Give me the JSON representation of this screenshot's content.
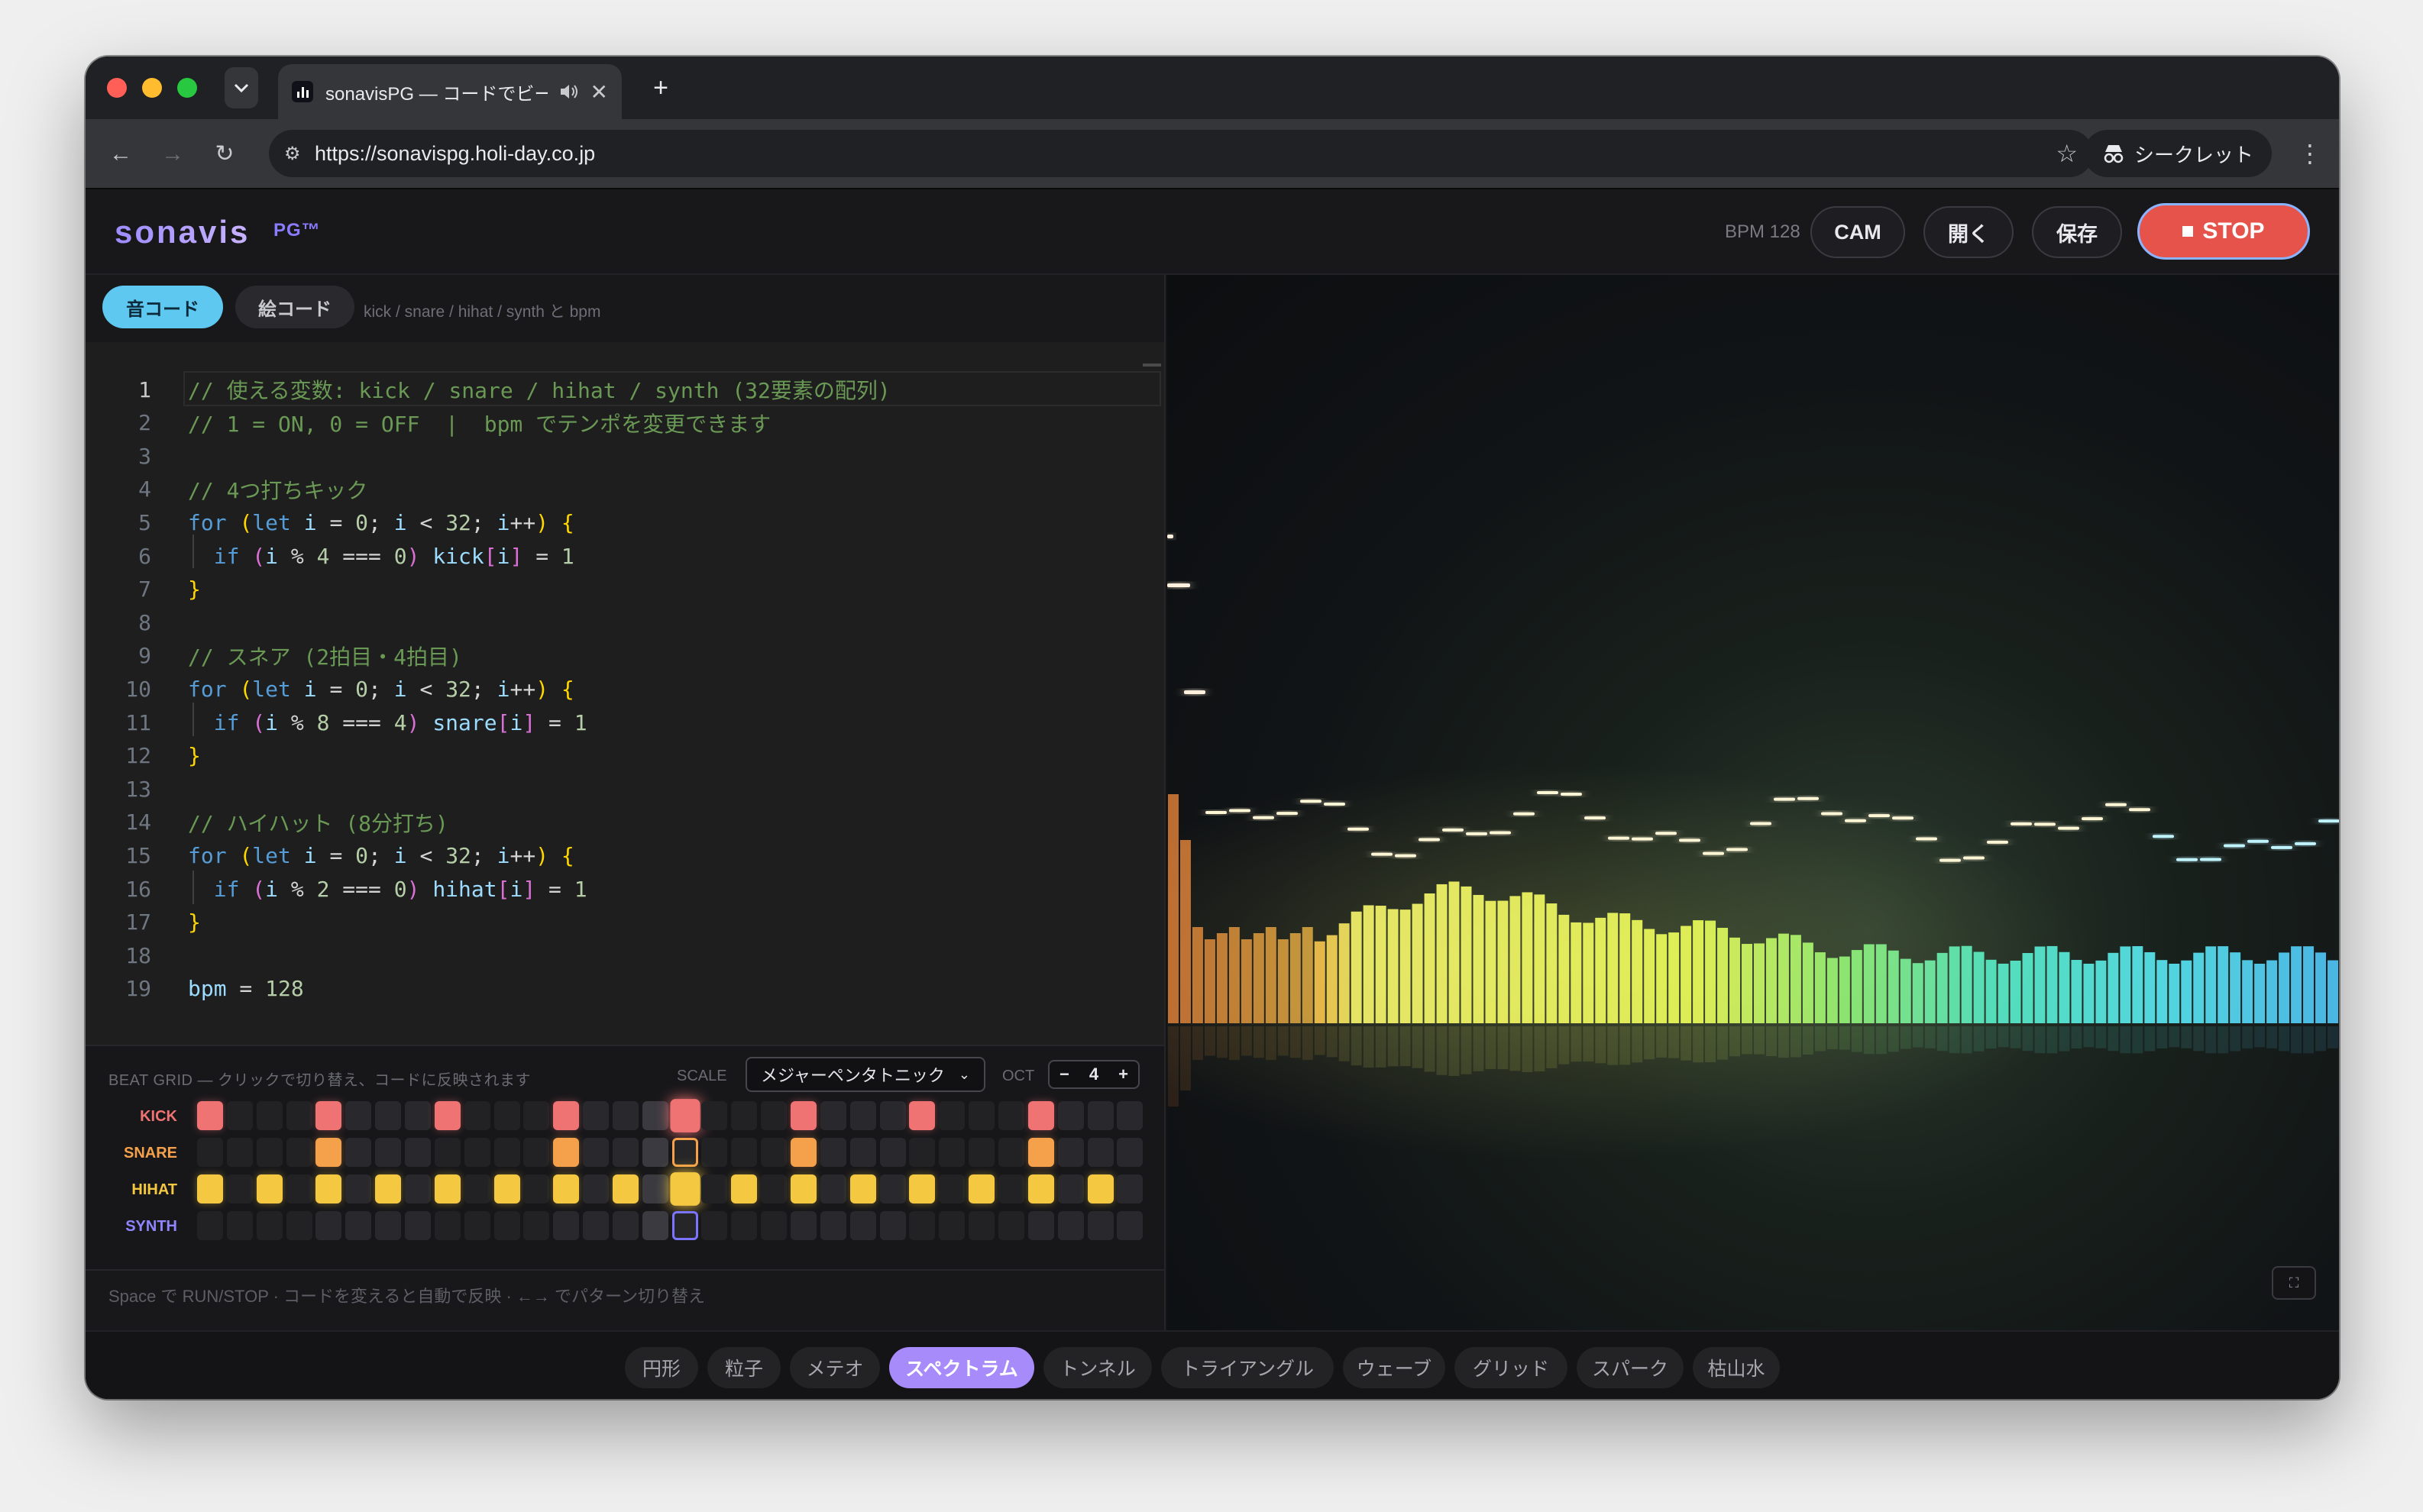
{
  "browser": {
    "tab_title": "sonavisPG — コードでビー",
    "tab_audio_icon": "speaker-icon",
    "url": "https://sonavispg.holi-day.co.jp",
    "incognito_label": "シークレット"
  },
  "app": {
    "logo": "sonavis",
    "logo_sub": "PG™",
    "bpm_label": "BPM 128",
    "buttons": {
      "cam": "CAM",
      "open": "開く",
      "save": "保存",
      "stop": "STOP"
    }
  },
  "modebar": {
    "sound_code": "音コード",
    "picture_code": "絵コード",
    "hint": "kick / snare / hihat / synth と bpm"
  },
  "editor": {
    "current_line": 1,
    "lines": [
      "// 使える変数: kick / snare / hihat / synth (32要素の配列)",
      "// 1 = ON, 0 = OFF  |  bpm でテンポを変更できます",
      "",
      "// 4つ打ちキック",
      "for (let i = 0; i < 32; i++) {",
      "  if (i % 4 === 0) kick[i] = 1",
      "}",
      "",
      "// スネア (2拍目・4拍目)",
      "for (let i = 0; i < 32; i++) {",
      "  if (i % 8 === 4) snare[i] = 1",
      "}",
      "",
      "// ハイハット (8分打ち)",
      "for (let i = 0; i < 32; i++) {",
      "  if (i % 2 === 0) hihat[i] = 1",
      "}",
      "",
      "bpm = 128"
    ]
  },
  "beat_grid": {
    "title": "BEAT GRID — クリックで切り替え、コードに反映されます",
    "scale_label": "SCALE",
    "scale_value": "メジャーペンタトニック",
    "oct_label": "OCT",
    "oct_value": "4",
    "playhead_step": 16,
    "tracks": [
      {
        "name": "KICK",
        "color": "#f07373",
        "steps": [
          0,
          4,
          8,
          12,
          16,
          20,
          24,
          28
        ]
      },
      {
        "name": "SNARE",
        "color": "#f5a04a",
        "steps": [
          4,
          12,
          20,
          28
        ]
      },
      {
        "name": "HIHAT",
        "color": "#f5c842",
        "steps": [
          0,
          2,
          4,
          6,
          8,
          10,
          12,
          14,
          16,
          18,
          20,
          22,
          24,
          26,
          28,
          30
        ]
      },
      {
        "name": "SYNTH",
        "color": "#8f86ff",
        "steps": []
      }
    ],
    "footnote": "Space で RUN/STOP · コードを変えると自動で反映 · ←→ でパターン切り替え"
  },
  "visual_modes": {
    "active": "スペクトラム",
    "items": [
      "円形",
      "粒子",
      "メテオ",
      "スペクトラム",
      "トンネル",
      "トライアングル",
      "ウェーブ",
      "グリッド",
      "スパーク",
      "枯山水"
    ]
  }
}
